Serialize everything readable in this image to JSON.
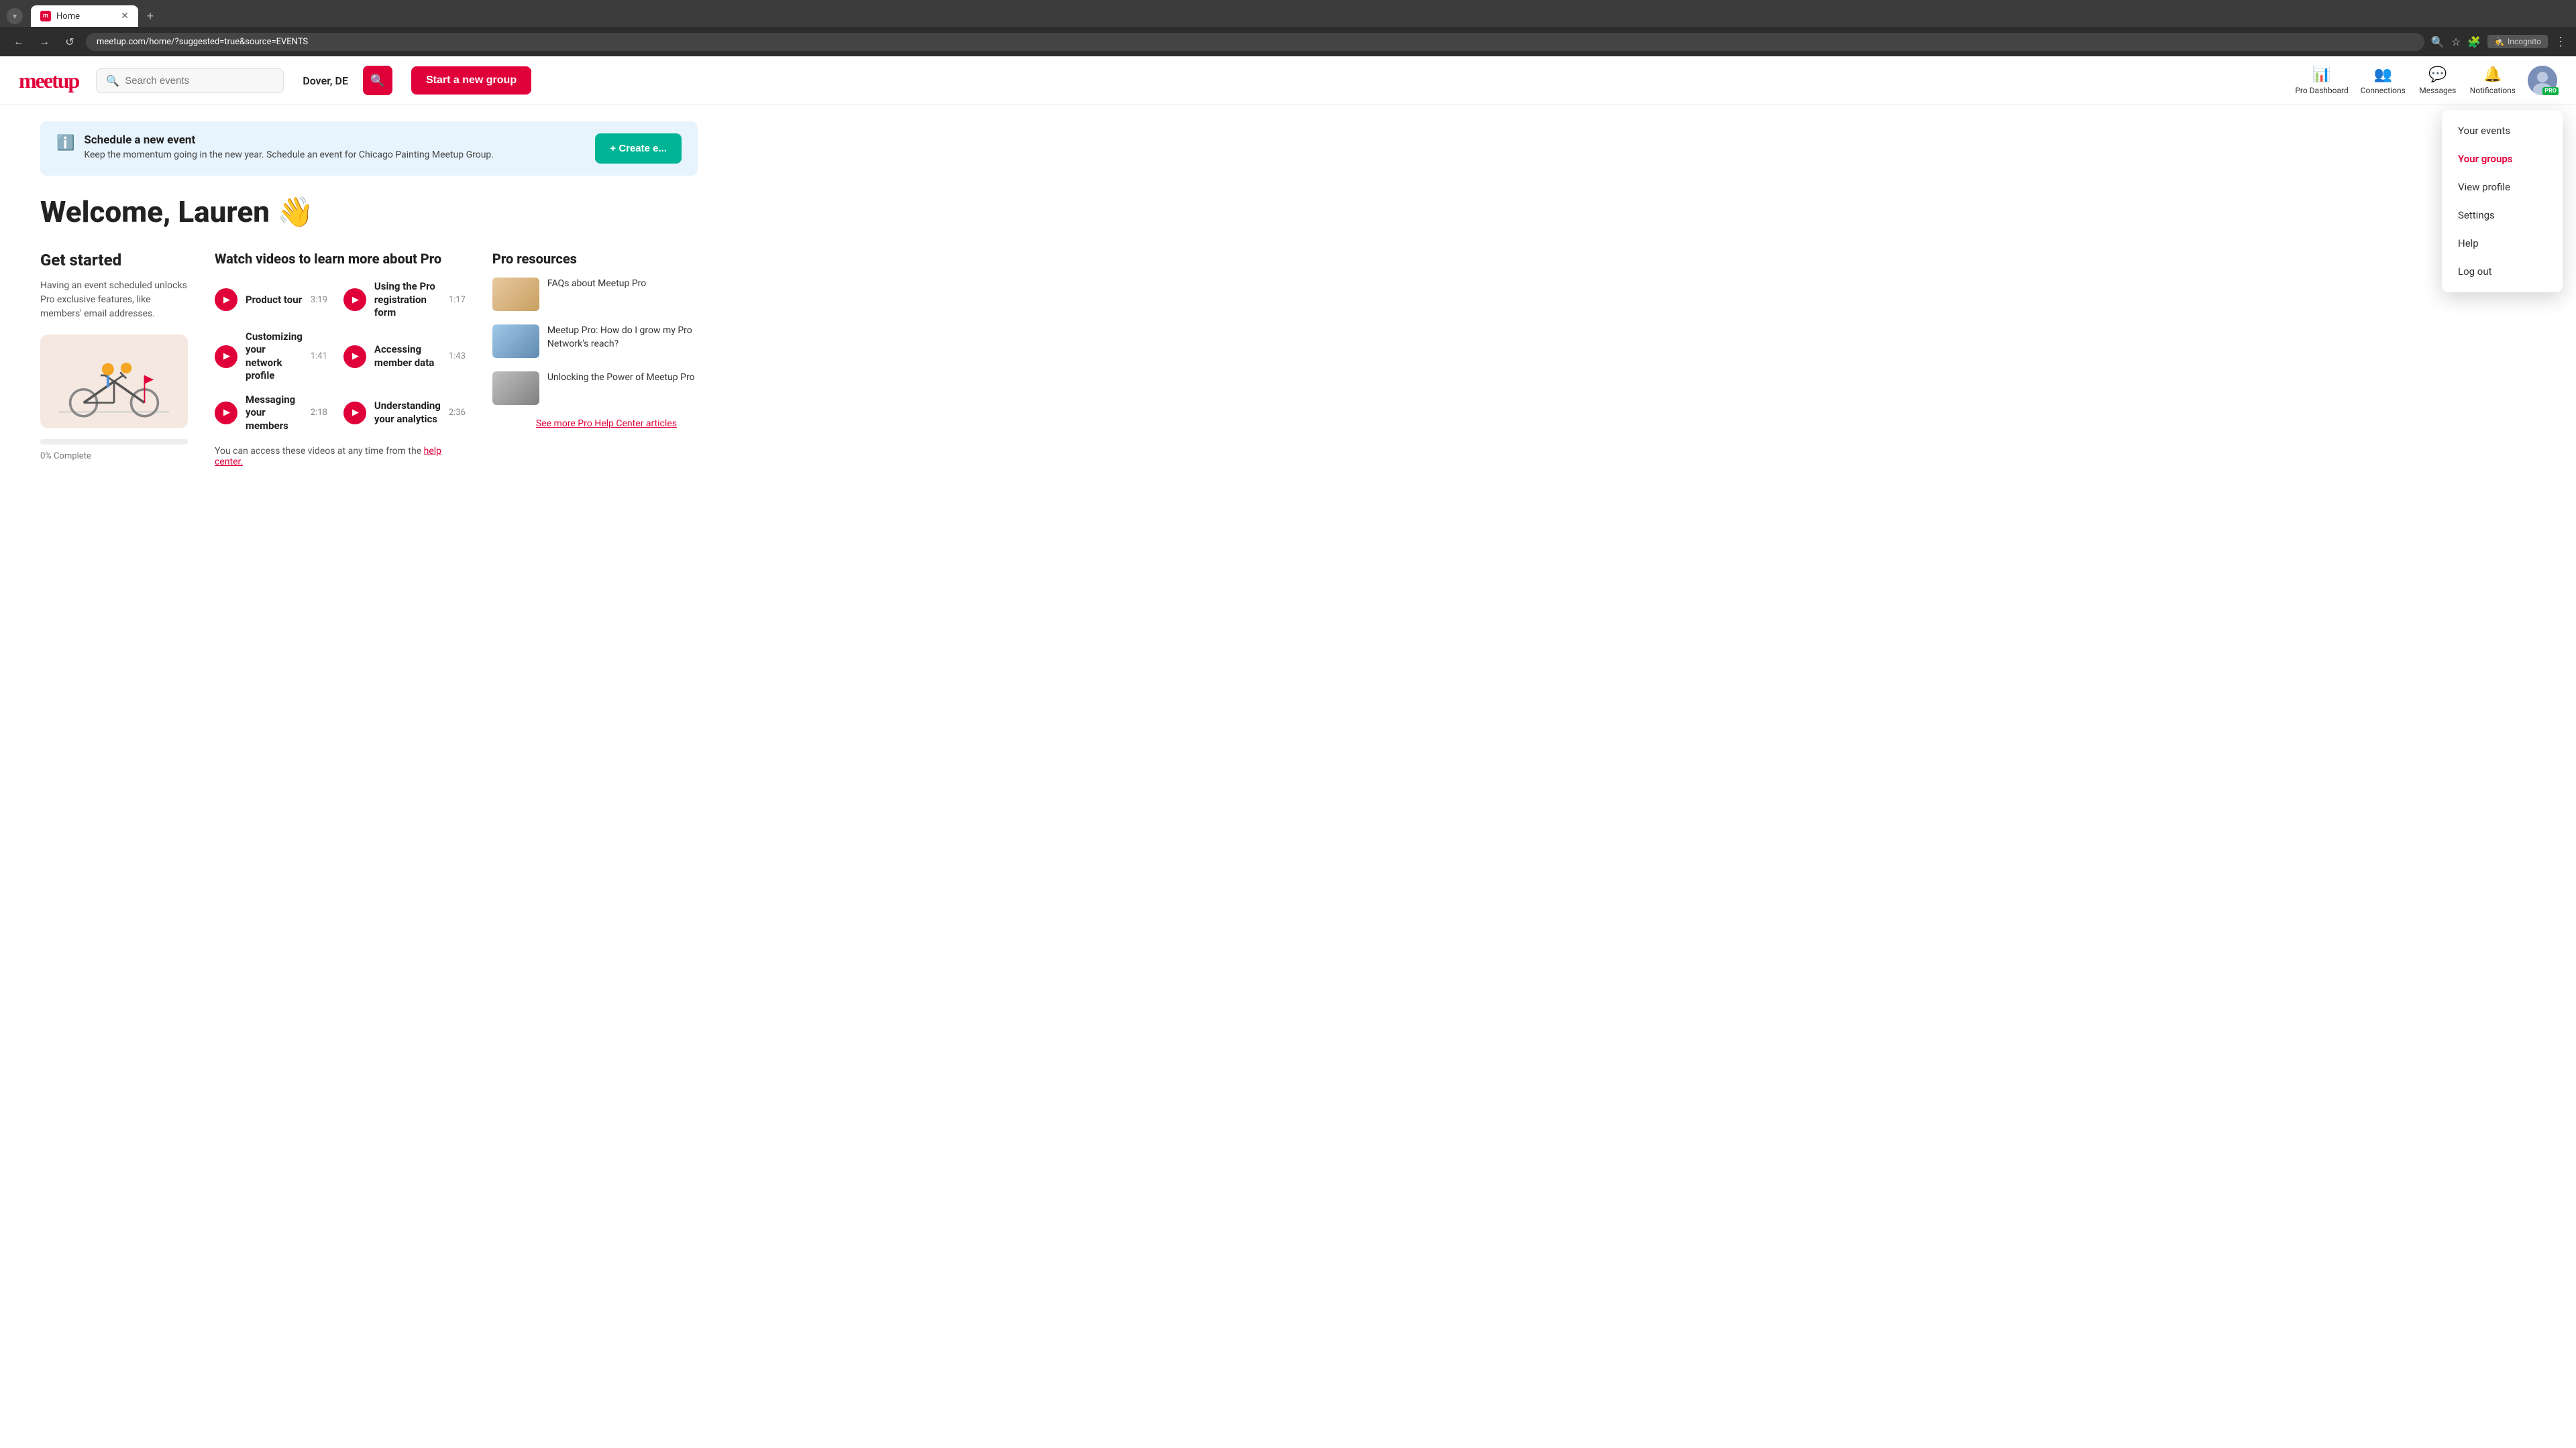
{
  "browser": {
    "tab_title": "Home",
    "url": "meetup.com/home/?suggested=true&source=EVENTS",
    "incognito_label": "Incognito"
  },
  "nav": {
    "logo": "meetup",
    "search_placeholder": "Search events",
    "location": "Dover, DE",
    "start_group_label": "Start a new group",
    "pro_dashboard_label": "Pro Dashboard",
    "connections_label": "Connections",
    "messages_label": "Messages",
    "notifications_label": "Notifications"
  },
  "dropdown": {
    "items": [
      {
        "label": "Your events",
        "id": "your-events"
      },
      {
        "label": "Your groups",
        "id": "your-groups",
        "active": true
      },
      {
        "label": "View profile",
        "id": "view-profile"
      },
      {
        "label": "Settings",
        "id": "settings"
      },
      {
        "label": "Help",
        "id": "help"
      },
      {
        "label": "Log out",
        "id": "log-out"
      }
    ]
  },
  "alert": {
    "title": "Schedule a new event",
    "body": "Keep the momentum going in the new year. Schedule an event for Chicago Painting Meetup Group.",
    "cta": "+ Create e..."
  },
  "welcome": {
    "heading": "Welcome, Lauren",
    "wave": "👋"
  },
  "get_started": {
    "heading": "Get started",
    "body": "Having an event scheduled unlocks Pro exclusive features, like members' email addresses.",
    "progress_pct": 0,
    "progress_label": "0% Complete"
  },
  "videos": {
    "heading": "Watch videos to learn more about Pro",
    "items": [
      {
        "title": "Product tour",
        "duration": "3:19"
      },
      {
        "title": "Using the Pro registration form",
        "duration": "1:17"
      },
      {
        "title": "Customizing your network profile",
        "duration": "1:41"
      },
      {
        "title": "Accessing member data",
        "duration": "1:43"
      },
      {
        "title": "Messaging your members",
        "duration": "2:18"
      },
      {
        "title": "Understanding your analytics",
        "duration": "2:36"
      }
    ],
    "help_text": "You can access these videos at any time from the",
    "help_link": "help center."
  },
  "pro_resources": {
    "heading": "Pro resources",
    "items": [
      {
        "title": "FAQs about Meetup Pro"
      },
      {
        "title": "Meetup Pro: How do I grow my Pro Network's reach?"
      },
      {
        "title": "Unlocking the Power of Meetup Pro"
      }
    ],
    "see_more": "See more Pro Help Center articles"
  }
}
